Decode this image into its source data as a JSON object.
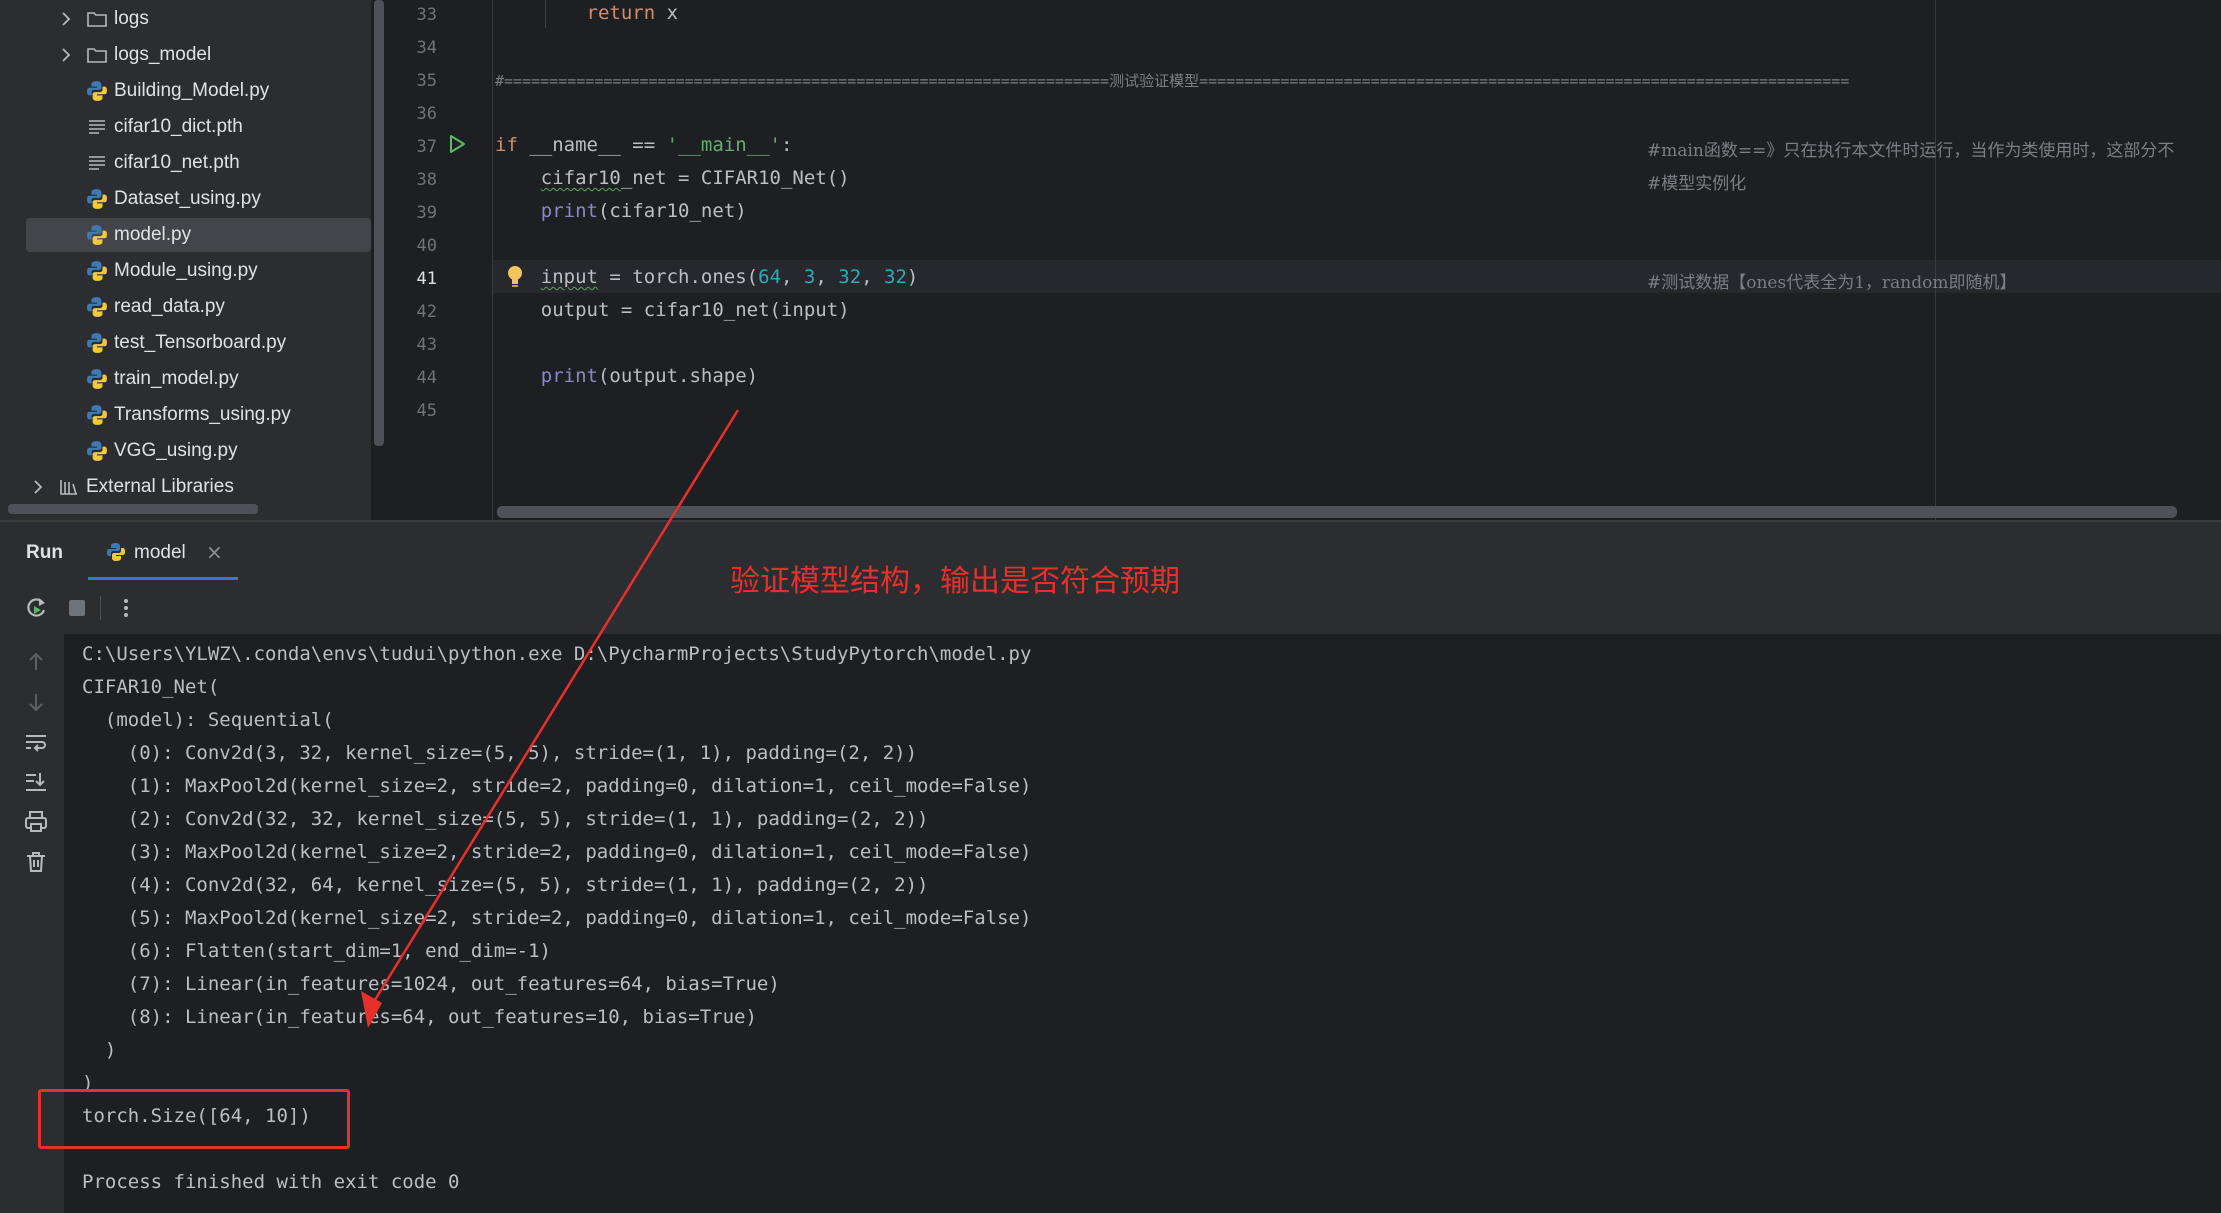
{
  "project_tree": {
    "items": [
      {
        "label": "logs",
        "type": "folder",
        "expandable": true
      },
      {
        "label": "logs_model",
        "type": "folder",
        "expandable": true
      },
      {
        "label": "Building_Model.py",
        "type": "python"
      },
      {
        "label": "cifar10_dict.pth",
        "type": "text"
      },
      {
        "label": "cifar10_net.pth",
        "type": "text"
      },
      {
        "label": "Dataset_using.py",
        "type": "python"
      },
      {
        "label": "model.py",
        "type": "python",
        "selected": true
      },
      {
        "label": "Module_using.py",
        "type": "python"
      },
      {
        "label": "read_data.py",
        "type": "python"
      },
      {
        "label": "test_Tensorboard.py",
        "type": "python"
      },
      {
        "label": "train_model.py",
        "type": "python"
      },
      {
        "label": "Transforms_using.py",
        "type": "python"
      },
      {
        "label": "VGG_using.py",
        "type": "python"
      },
      {
        "label": "External Libraries",
        "type": "library",
        "expandable": true
      }
    ]
  },
  "editor": {
    "current_line": "41",
    "lines": [
      {
        "num": "33",
        "indent": "        ",
        "kw": "return",
        "rest": " x"
      },
      {
        "num": "34"
      },
      {
        "num": "35",
        "comment": "#===================================================================测试验证模型========================================================================"
      },
      {
        "num": "36"
      },
      {
        "num": "37",
        "kw": "if",
        "rest": " __name__ == ",
        "str": "'__main__'",
        "tail": ":",
        "comment": "#main函数==》只在执行本文件时运行，当作为类使用时，这部分不"
      },
      {
        "num": "38",
        "indent": "    ",
        "wavy": "cifar10",
        "rest": "_net = CIFAR10_Net()",
        "comment": "#模型实例化"
      },
      {
        "num": "39",
        "indent": "    ",
        "bi": "print",
        "rest": "(cifar10_net)"
      },
      {
        "num": "40"
      },
      {
        "num": "41",
        "comment": "#测试数据【ones代表全为1，random即随机】"
      },
      {
        "num": "42",
        "indent": "    ",
        "rest": "output = cifar10_net(input)"
      },
      {
        "num": "43"
      },
      {
        "num": "44",
        "indent": "    ",
        "bi": "print",
        "rest": "(output.shape)"
      },
      {
        "num": "45"
      }
    ],
    "line41": {
      "indent": "    ",
      "var": "input",
      "mid": " = torch.ones(",
      "n1": "64",
      "s1": ", ",
      "n2": "3",
      "s2": ", ",
      "n3": "32",
      "s3": ", ",
      "n4": "32",
      "end": ")"
    }
  },
  "run_panel": {
    "title": "Run",
    "tab_label": "model",
    "tab_close": "×",
    "console_lines": [
      "C:\\Users\\YLWZ\\.conda\\envs\\tudui\\python.exe D:\\PycharmProjects\\StudyPytorch\\model.py",
      "CIFAR10_Net(",
      "  (model): Sequential(",
      "    (0): Conv2d(3, 32, kernel_size=(5, 5), stride=(1, 1), padding=(2, 2))",
      "    (1): MaxPool2d(kernel_size=2, stride=2, padding=0, dilation=1, ceil_mode=False)",
      "    (2): Conv2d(32, 32, kernel_size=(5, 5), stride=(1, 1), padding=(2, 2))",
      "    (3): MaxPool2d(kernel_size=2, stride=2, padding=0, dilation=1, ceil_mode=False)",
      "    (4): Conv2d(32, 64, kernel_size=(5, 5), stride=(1, 1), padding=(2, 2))",
      "    (5): MaxPool2d(kernel_size=2, stride=2, padding=0, dilation=1, ceil_mode=False)",
      "    (6): Flatten(start_dim=1, end_dim=-1)",
      "    (7): Linear(in_features=1024, out_features=64, bias=True)",
      "    (8): Linear(in_features=64, out_features=10, bias=True)",
      "  )",
      ")",
      "torch.Size([64, 10])",
      "",
      "Process finished with exit code 0"
    ]
  },
  "annotation": {
    "text": "验证模型结构，输出是否符合预期",
    "color": "#e8302a"
  },
  "colors": {
    "keyword": "#cf8e6d",
    "string": "#6aab73",
    "number": "#2aacb8",
    "builtin": "#8888c6",
    "comment": "#7a7e85",
    "accent": "#3574f0"
  }
}
